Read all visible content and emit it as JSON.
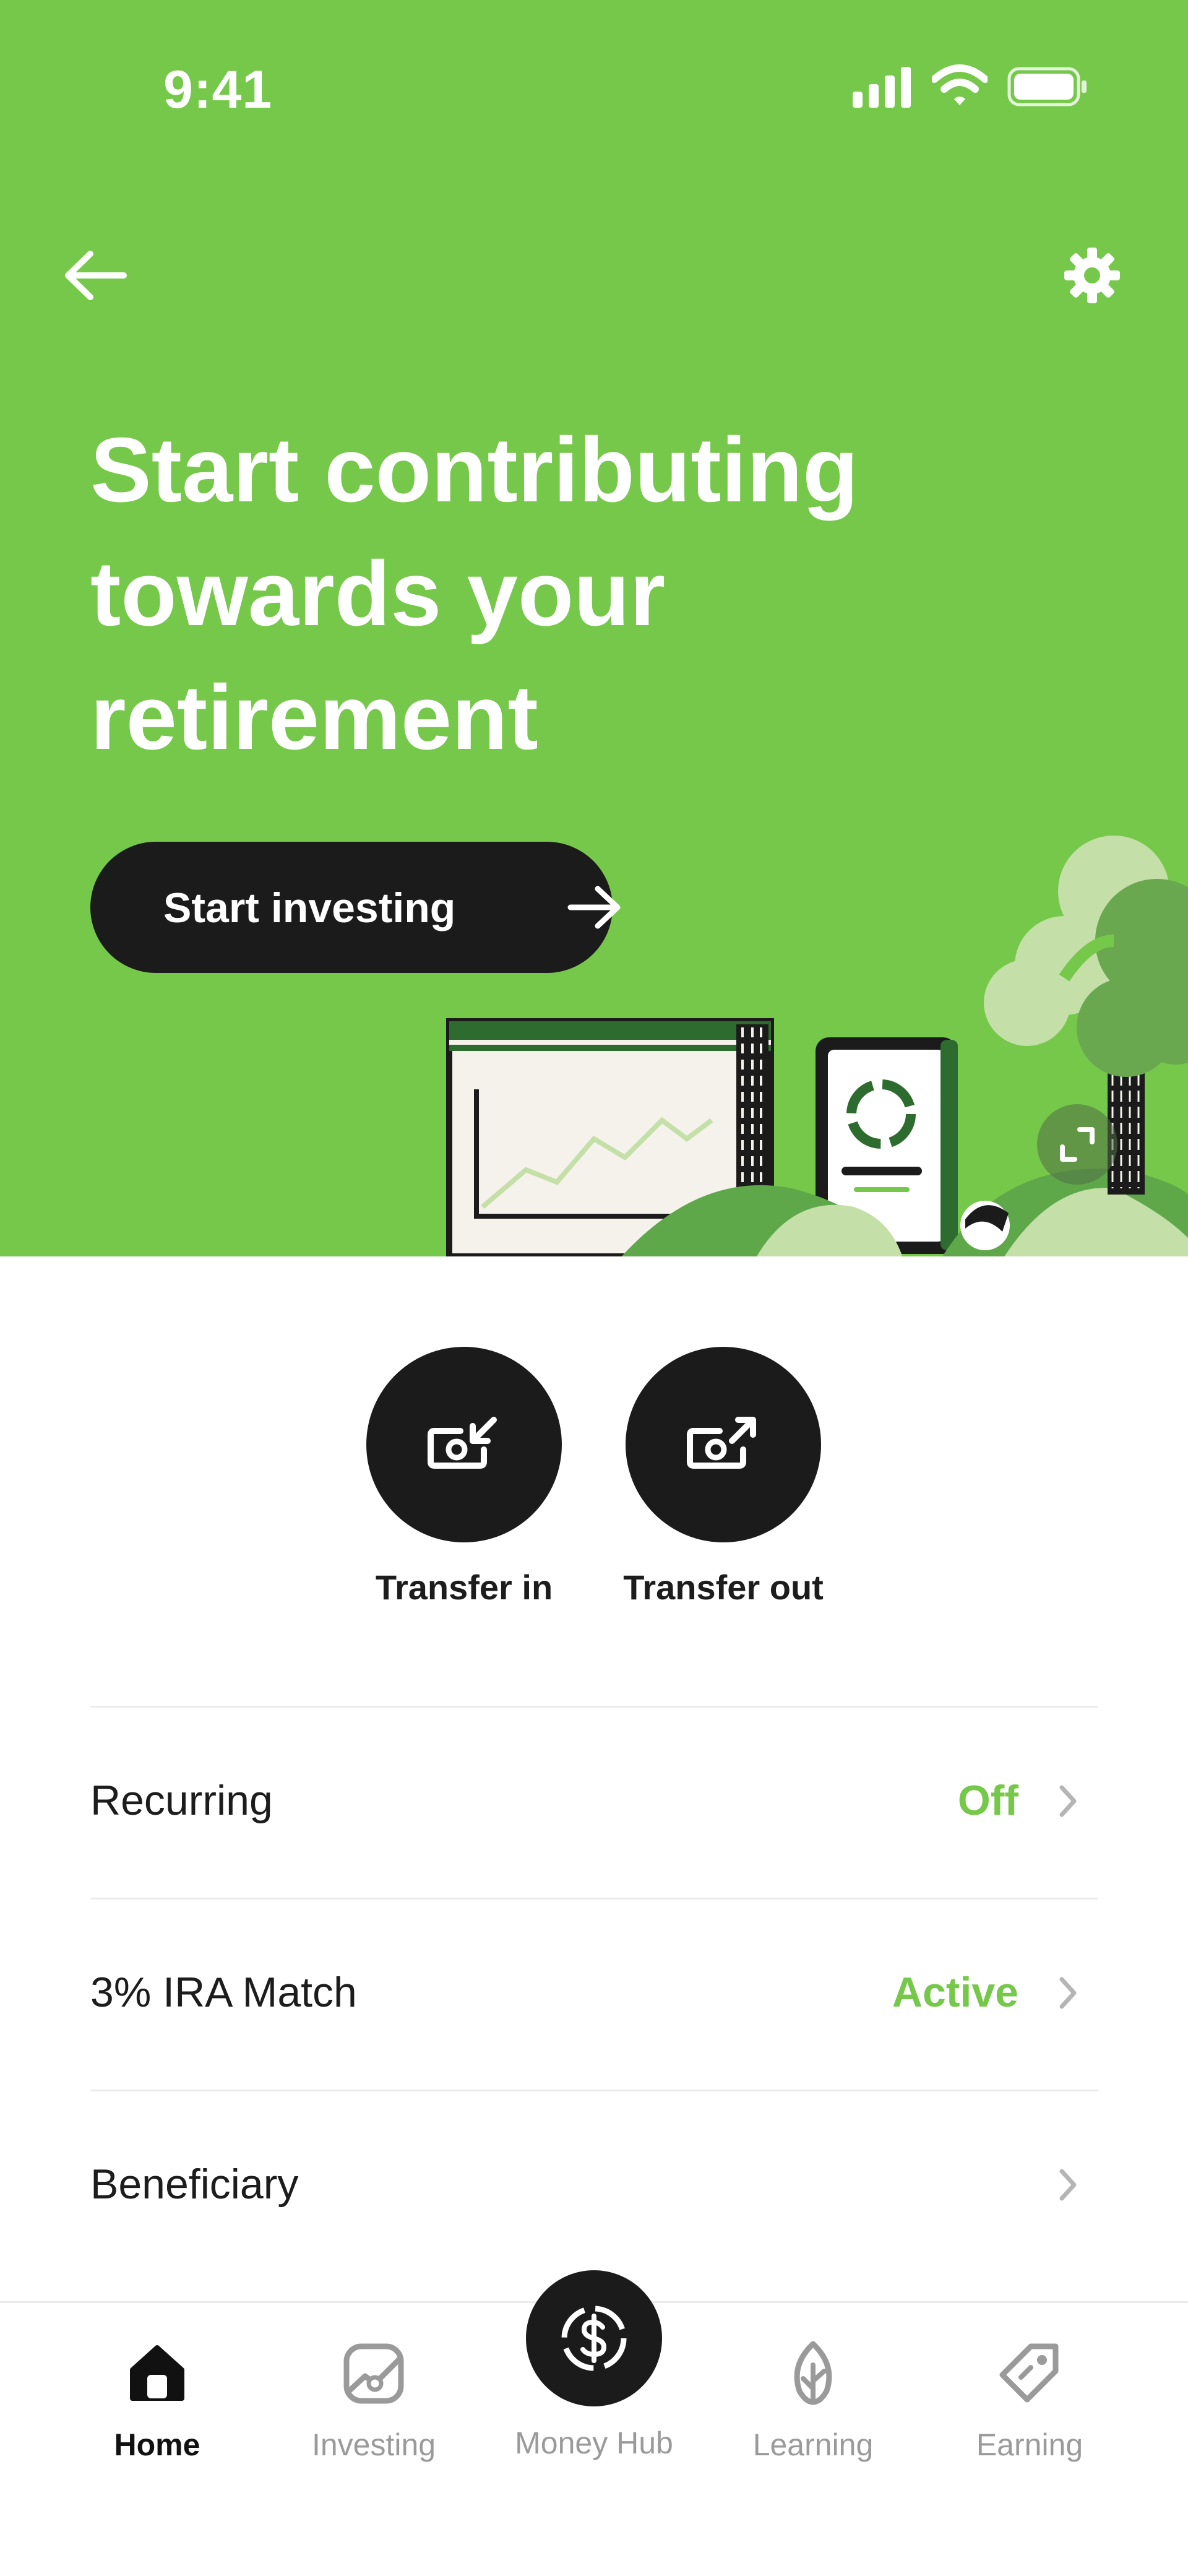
{
  "status_bar": {
    "time": "9:41",
    "icons": [
      "signal-icon",
      "wifi-icon",
      "battery-icon"
    ]
  },
  "header": {
    "back_icon": "arrow-left-icon",
    "settings_icon": "gear-icon"
  },
  "hero": {
    "title": "Start contributing towards your retirement",
    "button_label": "Start investing",
    "button_icon": "arrow-right-icon",
    "background_color": "#76c84a"
  },
  "transfers": [
    {
      "label": "Transfer in",
      "icon": "transfer-in-icon"
    },
    {
      "label": "Transfer out",
      "icon": "transfer-out-icon"
    }
  ],
  "rows": [
    {
      "label": "Recurring",
      "value": "Off"
    },
    {
      "label": "3% IRA Match",
      "value": "Active"
    },
    {
      "label": "Beneficiary",
      "value": ""
    }
  ],
  "tabs": [
    {
      "label": "Home",
      "icon": "home-icon",
      "active": true
    },
    {
      "label": "Investing",
      "icon": "investing-icon",
      "active": false
    },
    {
      "label": "Money Hub",
      "icon": "dollar-icon",
      "active": false
    },
    {
      "label": "Learning",
      "icon": "leaf-icon",
      "active": false
    },
    {
      "label": "Earning",
      "icon": "tag-icon",
      "active": false
    }
  ],
  "colors": {
    "accent": "#76c84a",
    "dark": "#1b1b1b"
  }
}
